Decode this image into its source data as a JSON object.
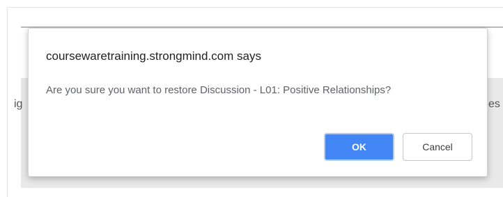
{
  "background": {
    "left_fragment": "ig",
    "right_fragment": "es"
  },
  "dialog": {
    "title": "coursewaretraining.strongmind.com says",
    "message": "Are you sure you want to restore Discussion - L01: Positive Relationships?",
    "ok_label": "OK",
    "cancel_label": "Cancel"
  },
  "colors": {
    "ok_button": "#4285f4",
    "ok_button_text": "#ffffff",
    "cancel_border": "#c6c6c6"
  }
}
